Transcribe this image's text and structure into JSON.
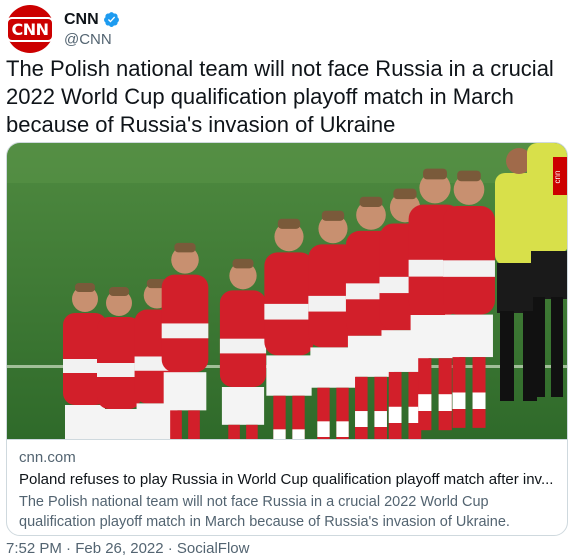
{
  "author": {
    "display_name": "CNN",
    "handle": "@CNN",
    "avatar_text": "CNN",
    "verified_icon": "verified-badge-icon",
    "avatar_color": "#cc0000",
    "verified_color": "#1d9bf0"
  },
  "tweet": {
    "text": "The Polish national team will not face Russia in a crucial 2022 World Cup qualification playoff match in March because of Russia's invasion of Ukraine"
  },
  "card": {
    "image_badge": "cnn",
    "domain": "cnn.com",
    "title": "Poland refuses to play Russia in World Cup qualification playoff match after inv...",
    "description": "The Polish national team will not face Russia in a crucial 2022 World Cup qualification playoff match in March because of Russia's invasion of Ukraine."
  },
  "footer": {
    "meta": "7:52 PM · Feb 26, 2022 · SocialFlow"
  },
  "colors": {
    "text_primary": "#0f1419",
    "text_secondary": "#536471",
    "border": "#cfd9de",
    "jersey_red": "#d21f2a",
    "pitch_green": "#3e7a35",
    "referee_yellow": "#d8e04a"
  }
}
